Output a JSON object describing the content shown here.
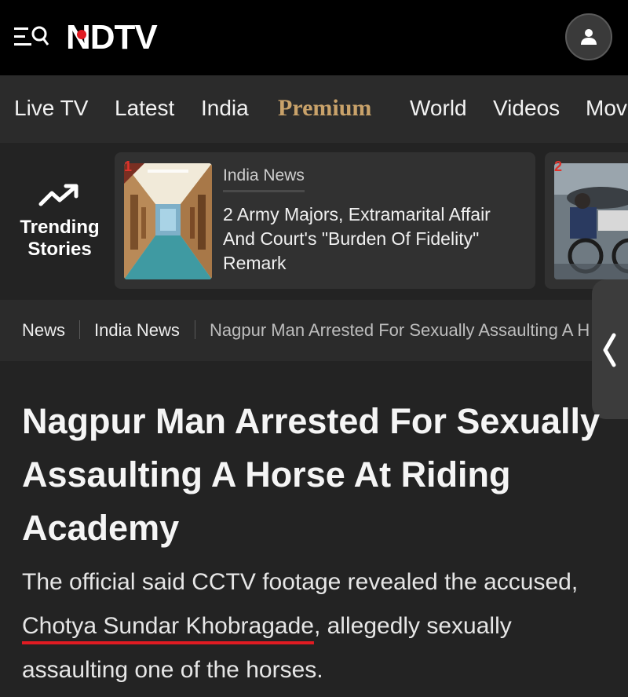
{
  "header": {
    "logo": {
      "before_dot": "N",
      "after_dot": "DTV"
    },
    "icons": {
      "menu": "menu-search-icon",
      "account": "user-icon"
    }
  },
  "nav": {
    "items": [
      {
        "label": "Live TV"
      },
      {
        "label": "Latest"
      },
      {
        "label": "India"
      },
      {
        "label": "Premium"
      },
      {
        "label": "World"
      },
      {
        "label": "Videos"
      },
      {
        "label": "Mov"
      }
    ]
  },
  "trending": {
    "label_line1": "Trending",
    "label_line2": "Stories",
    "icon": "trending-up-icon",
    "cards": [
      {
        "number": "1",
        "category": "India News",
        "title": "2 Army Majors, Extramarital Affair And Court's \"Burden Of Fidelity\" Remark"
      },
      {
        "number": "2"
      }
    ]
  },
  "breadcrumb": {
    "items": [
      "News",
      "India News",
      "Nagpur Man Arrested For Sexually Assaulting A H"
    ]
  },
  "side_handle": {
    "icon": "chevron-left-icon"
  },
  "article": {
    "headline": "Nagpur Man Arrested For Sexually Assaulting A Horse At Riding Academy",
    "summary_before": "The official said CCTV footage revealed the accused, ",
    "summary_name": "Chotya Sundar Khobragade",
    "summary_after": ", allegedly sexually assaulting one of the horses."
  },
  "colors": {
    "brand_red": "#e11b22",
    "premium_gold": "#c9a26a",
    "background": "#232323",
    "topbar": "#000000"
  }
}
